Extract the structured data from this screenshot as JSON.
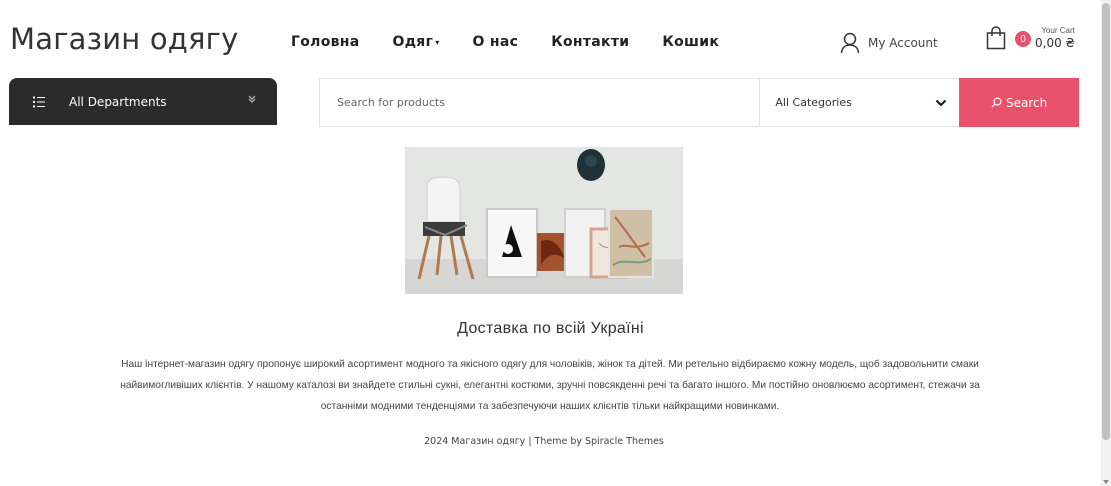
{
  "site": {
    "title": "Магазин одягу"
  },
  "nav": {
    "items": [
      {
        "label": "Головна"
      },
      {
        "label": "Одяг",
        "caret": "▾"
      },
      {
        "label": "О нас"
      },
      {
        "label": "Контакти"
      },
      {
        "label": "Кошик"
      }
    ]
  },
  "header": {
    "account_label": "My Account",
    "account_icon": "user-icon",
    "cart_icon": "shopping-bag-icon",
    "cart_count": "0",
    "cart_label": "Your Cart",
    "cart_total": "0,00 ₴"
  },
  "departments": {
    "label": "All Departments",
    "icon": "list-icon",
    "chevron": "»"
  },
  "search": {
    "placeholder": "Search for products",
    "category_selected": "All Categories",
    "button_label": "Search"
  },
  "content": {
    "title": "Доставка по всій Україні",
    "description": "Наш інтернет-магазин одягу пропонує широкий асортимент модного та якісного одягу для чоловіків, жінок та дітей. Ми ретельно відбираємо кожну модель, щоб задовольнити смаки найвимогливіших клієнтів. У нашому каталозі ви знайдете стильні сукні, елегантні костюми, зручні повсякденні речі та багато іншого. Ми постійно оновлюємо асортимент, стежачи за останніми модними тенденціями та забезпечуючи наших клієнтів тільки найкращими новинками."
  },
  "footer": {
    "text": "2024 Магазин одягу | Theme by Spiracle Themes"
  },
  "colors": {
    "accent": "#e8526a",
    "dark": "#2b2b2b"
  }
}
